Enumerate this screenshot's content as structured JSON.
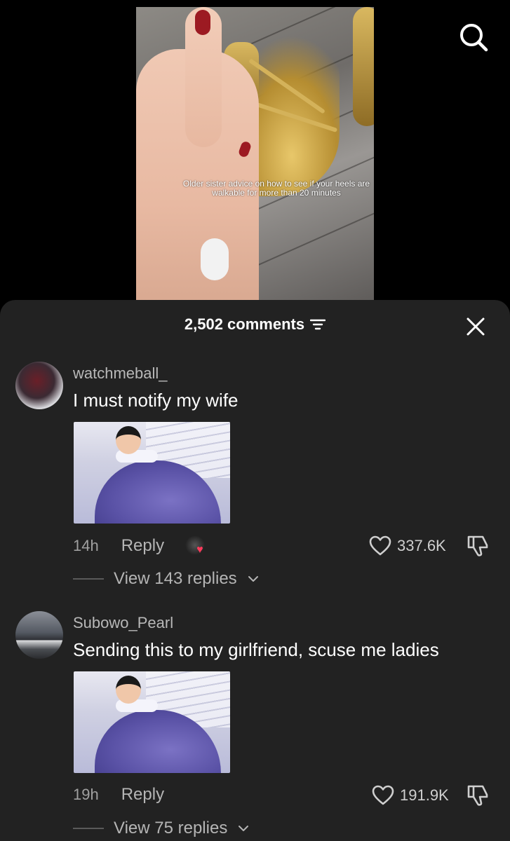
{
  "video": {
    "caption_overlay": "Older sister advice on how to see if your heels are walkable for more than 20 minutes",
    "search_icon": "search-icon"
  },
  "comments_sheet": {
    "count_label": "2,502 comments",
    "filter_icon": "filter-icon",
    "close_icon": "close-icon"
  },
  "comments": [
    {
      "username": "watchmeball_",
      "text": "I must notify my wife",
      "time": "14h",
      "reply_label": "Reply",
      "likes": "337.6K",
      "view_replies": "View 143 replies",
      "creator_liked": true
    },
    {
      "username": "Subowo_Pearl",
      "text": "Sending this to my girlfriend, scuse me ladies",
      "time": "19h",
      "reply_label": "Reply",
      "likes": "191.9K",
      "view_replies": "View 75 replies",
      "creator_liked": false
    }
  ],
  "colors": {
    "sheet_bg": "#222222",
    "muted_text": "#a0a0a0",
    "heart_badge": "#ff3b5c",
    "nail_red": "#9c1a22",
    "gold": "#c9a54a"
  }
}
